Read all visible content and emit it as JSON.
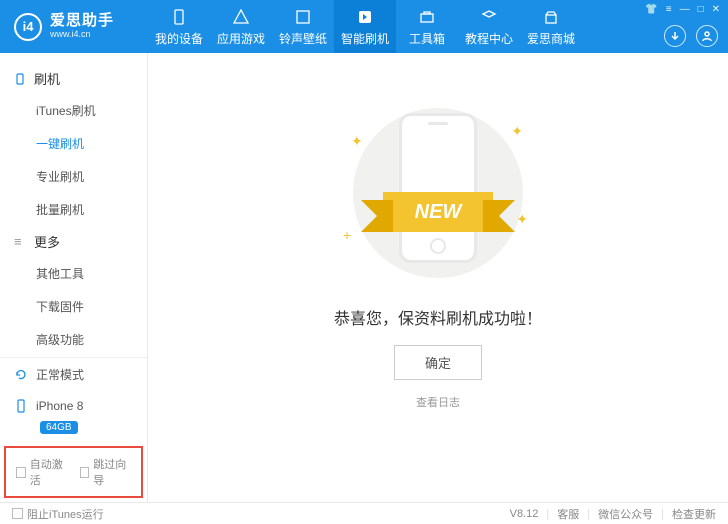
{
  "header": {
    "brand": "爱思助手",
    "brand_url": "www.i4.cn",
    "logo_text": "i4",
    "nav": [
      {
        "label": "我的设备"
      },
      {
        "label": "应用游戏"
      },
      {
        "label": "铃声壁纸"
      },
      {
        "label": "智能刷机"
      },
      {
        "label": "工具箱"
      },
      {
        "label": "教程中心"
      },
      {
        "label": "爱思商城"
      }
    ]
  },
  "sidebar": {
    "group1": {
      "title": "刷机",
      "items": [
        "iTunes刷机",
        "一键刷机",
        "专业刷机",
        "批量刷机"
      ]
    },
    "group2": {
      "title": "更多",
      "items": [
        "其他工具",
        "下载固件",
        "高级功能"
      ]
    },
    "mode": "正常模式",
    "device": {
      "name": "iPhone 8",
      "storage": "64GB"
    },
    "checks": {
      "auto_activate": "自动激活",
      "skip_guide": "跳过向导"
    }
  },
  "main": {
    "ribbon": "NEW",
    "message": "恭喜您，保资料刷机成功啦！",
    "ok_button": "确定",
    "view_log": "查看日志"
  },
  "footer": {
    "block_itunes": "阻止iTunes运行",
    "version": "V8.12",
    "service": "客服",
    "wechat": "微信公众号",
    "update": "检查更新"
  }
}
